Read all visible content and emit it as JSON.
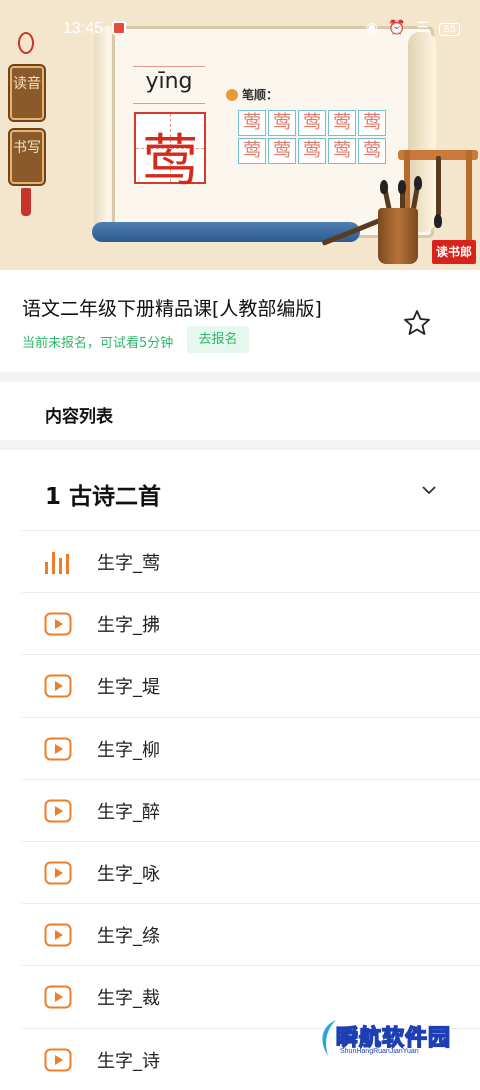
{
  "status_bar": {
    "time": "13:45",
    "battery": "85"
  },
  "hero": {
    "pinyin": "yīng",
    "character": "莺",
    "stroke_order_label": "笔顺：",
    "stroke_cells": [
      "莺",
      "莺",
      "莺",
      "莺",
      "莺",
      "莺",
      "莺",
      "莺",
      "莺",
      "莺"
    ],
    "side_tags": [
      "读音",
      "书写"
    ],
    "brand_badge": "读书郎"
  },
  "course": {
    "title": "语文二年级下册精品课[人教部编版]",
    "trial_text": "当前未报名，可试看5分钟",
    "enroll_label": "去报名"
  },
  "content_list": {
    "header": "内容列表",
    "chapter_title": "1 古诗二首",
    "lessons": [
      {
        "label": "生字_莺",
        "icon": "audio-bars-icon",
        "playing": true
      },
      {
        "label": "生字_拂",
        "icon": "play-icon"
      },
      {
        "label": "生字_堤",
        "icon": "play-icon"
      },
      {
        "label": "生字_柳",
        "icon": "play-icon"
      },
      {
        "label": "生字_醉",
        "icon": "play-icon"
      },
      {
        "label": "生字_咏",
        "icon": "play-icon"
      },
      {
        "label": "生字_绦",
        "icon": "play-icon"
      },
      {
        "label": "生字_裁",
        "icon": "play-icon"
      },
      {
        "label": "生字_诗",
        "icon": "play-icon"
      }
    ]
  },
  "watermark": {
    "title": "瞬航软件园",
    "subtitle": "ShunHangRuanJianYuan"
  },
  "colors": {
    "accent_orange": "#f07c2a",
    "green": "#2fb66a",
    "red": "#d32a1c"
  }
}
